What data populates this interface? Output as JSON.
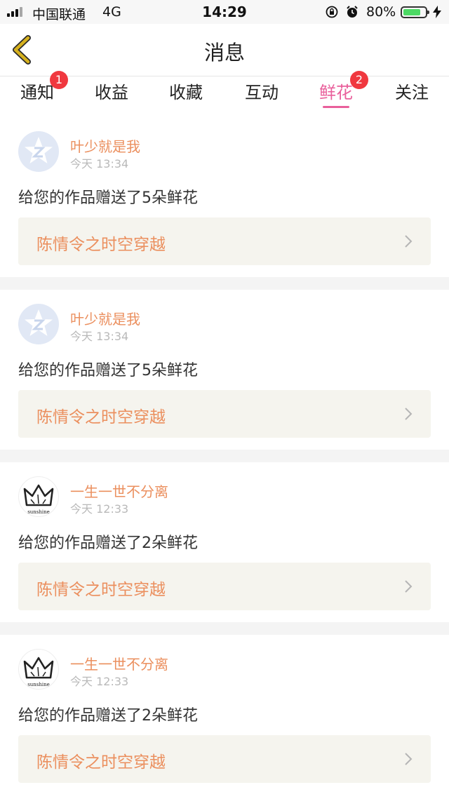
{
  "status_bar": {
    "carrier": "中国联通",
    "network": "4G",
    "time": "14:29",
    "battery_percent": "80%",
    "battery_level": 0.8,
    "icons": [
      "signal-icon",
      "orientation-lock-icon",
      "alarm-icon",
      "battery-icon",
      "charging-icon"
    ]
  },
  "header": {
    "title": "消息",
    "back_icon": "chevron-left-icon",
    "back_color": "#d6b11e"
  },
  "tabs": [
    {
      "label": "通知",
      "badge": "1",
      "active": false
    },
    {
      "label": "收益",
      "badge": "",
      "active": false
    },
    {
      "label": "收藏",
      "badge": "",
      "active": false
    },
    {
      "label": "互动",
      "badge": "",
      "active": false
    },
    {
      "label": "鲜花",
      "badge": "2",
      "active": true
    },
    {
      "label": "关注",
      "badge": "",
      "active": false
    }
  ],
  "colors": {
    "accent_pink": "#e95f9b",
    "badge_red": "#f0383f",
    "name_orange": "#eb8f5e",
    "card_bg": "#f5f4ee"
  },
  "messages": [
    {
      "avatar": "qq-default-avatar",
      "sender": "叶少就是我",
      "time": "今天 13:34",
      "text": "给您的作品赠送了5朵鲜花",
      "work": "陈情令之时空穿越"
    },
    {
      "avatar": "qq-default-avatar",
      "sender": "叶少就是我",
      "time": "今天 13:34",
      "text": "给您的作品赠送了5朵鲜花",
      "work": "陈情令之时空穿越"
    },
    {
      "avatar": "crown-avatar",
      "avatar_caption": "sunshine",
      "sender": "一生一世不分离",
      "time": "今天 12:33",
      "text": "给您的作品赠送了2朵鲜花",
      "work": "陈情令之时空穿越"
    },
    {
      "avatar": "crown-avatar",
      "avatar_caption": "sunshine",
      "sender": "一生一世不分离",
      "time": "今天 12:33",
      "text": "给您的作品赠送了2朵鲜花",
      "work": "陈情令之时空穿越"
    }
  ]
}
